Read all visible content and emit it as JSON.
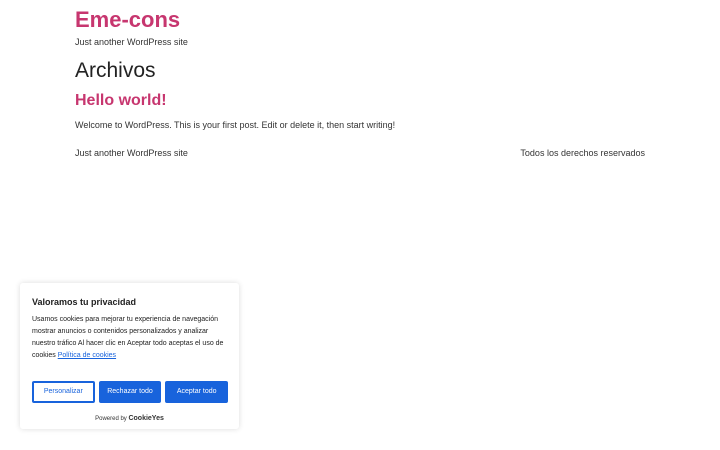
{
  "site": {
    "title": "Eme-cons",
    "tagline": "Just another WordPress site"
  },
  "archive": {
    "heading": "Archivos"
  },
  "post": {
    "title": "Hello world!",
    "excerpt": "Welcome to WordPress. This is your first post. Edit or delete it, then start writing!"
  },
  "footer": {
    "left_text": "Just another WordPress site",
    "right_text": "Todos los derechos reservados"
  },
  "cookie_banner": {
    "title": "Valoramos tu privacidad",
    "text": "Usamos cookies para mejorar tu experiencia de navegación mostrar anuncios o contenidos personalizados y analizar nuestro tráfico Al hacer clic en Aceptar todo aceptas el uso de cookies ",
    "policy_link": "Política de cookies",
    "buttons": {
      "customize": "Personalizar",
      "reject": "Rechazar todo",
      "accept": "Aceptar todo"
    },
    "powered_by": "Powered by",
    "brand": "CookieYes"
  },
  "colors": {
    "accent": "#c7366f",
    "cookie_blue": "#1863dc"
  }
}
